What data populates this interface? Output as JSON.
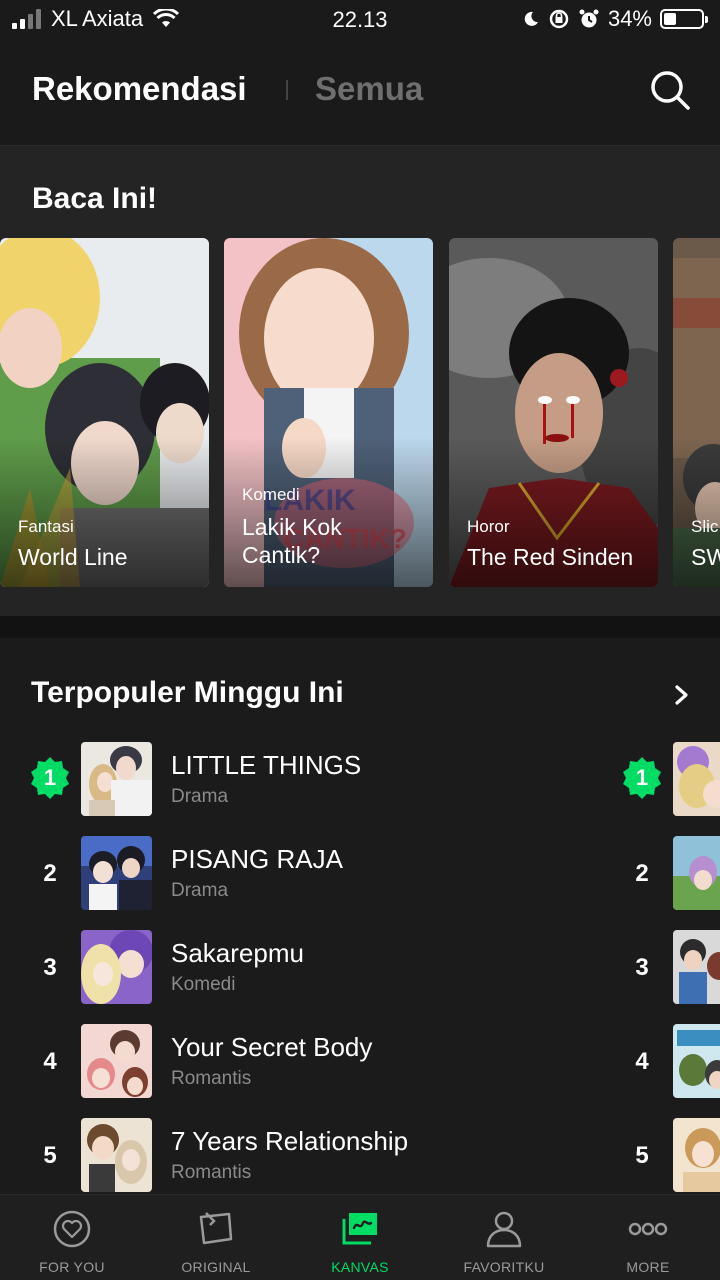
{
  "status_bar": {
    "carrier": "XL Axiata",
    "time": "22.13",
    "battery": "34%",
    "battery_level": 0.34
  },
  "header": {
    "tab_active": "Rekomendasi",
    "tab_inactive": "Semua",
    "search_icon": "search-icon"
  },
  "baca": {
    "title": "Baca Ini!",
    "cards": [
      {
        "genre": "Fantasi",
        "title": "World Line"
      },
      {
        "genre": "Komedi",
        "title": "Lakik Kok Cantik?"
      },
      {
        "genre": "Horor",
        "title": "The Red Sinden"
      },
      {
        "genre": "Slic",
        "title": "SW"
      }
    ]
  },
  "popular": {
    "title": "Terpopuler Minggu Ini",
    "items": [
      {
        "rank": "1",
        "title": "LITTLE THINGS",
        "genre": "Drama"
      },
      {
        "rank": "2",
        "title": "PISANG RAJA",
        "genre": "Drama"
      },
      {
        "rank": "3",
        "title": "Sakarepmu",
        "genre": "Komedi"
      },
      {
        "rank": "4",
        "title": "Your Secret Body",
        "genre": "Romantis"
      },
      {
        "rank": "5",
        "title": "7 Years Relationship",
        "genre": "Romantis"
      }
    ],
    "second_column_ranks": [
      "1",
      "2",
      "3",
      "4",
      "5"
    ]
  },
  "nav": {
    "items": [
      {
        "label": "FOR YOU",
        "icon": "heart-circle-icon"
      },
      {
        "label": "ORIGINAL",
        "icon": "book-icon"
      },
      {
        "label": "KANVAS",
        "icon": "canvas-icon"
      },
      {
        "label": "FAVORITKU",
        "icon": "person-icon"
      },
      {
        "label": "MORE",
        "icon": "more-dots-icon"
      }
    ],
    "active_index": 2
  },
  "colors": {
    "accent": "#00dc64",
    "background": "#121212",
    "muted_text": "#8a8a8a"
  }
}
